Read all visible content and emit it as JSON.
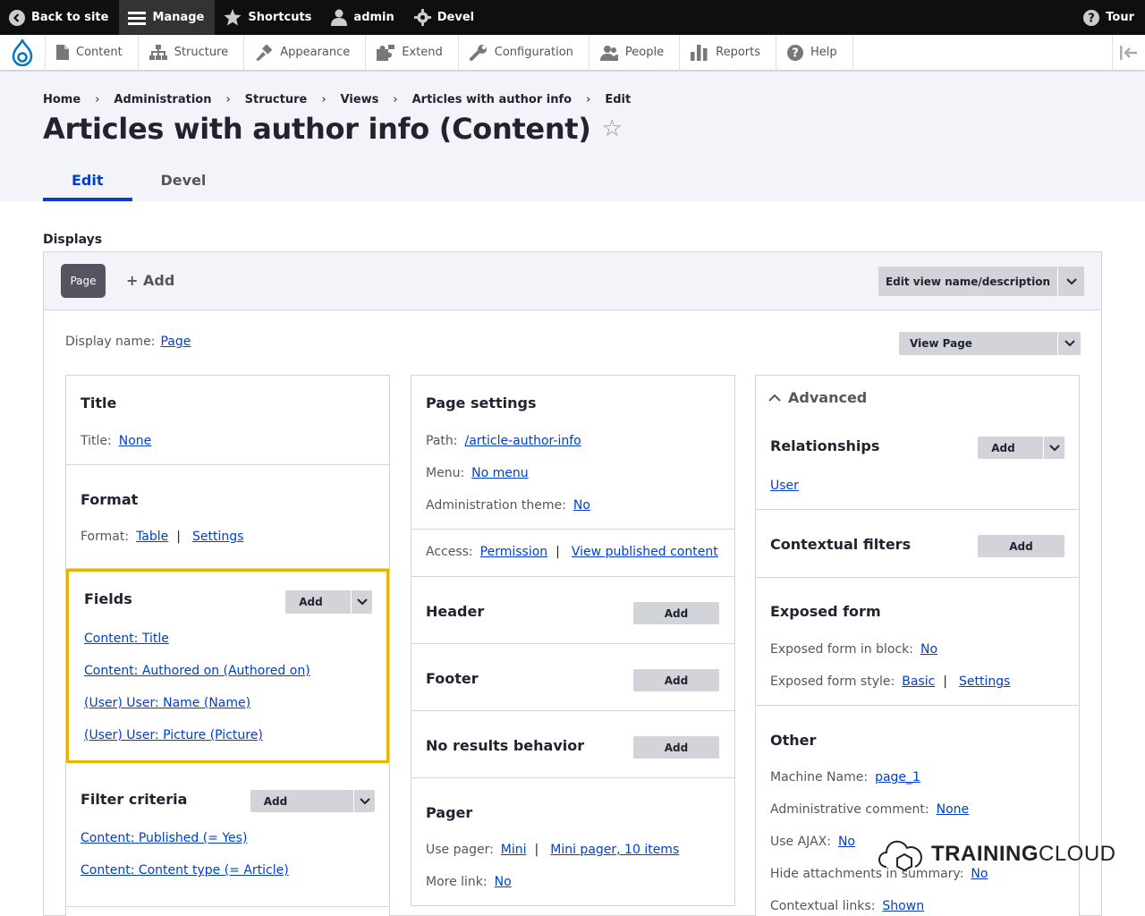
{
  "toolbar": {
    "back_to_site": "Back to site",
    "manage": "Manage",
    "shortcuts": "Shortcuts",
    "user": "admin",
    "devel": "Devel",
    "tour": "Tour"
  },
  "tray": {
    "items": [
      "Content",
      "Structure",
      "Appearance",
      "Extend",
      "Configuration",
      "People",
      "Reports",
      "Help"
    ]
  },
  "breadcrumb": [
    "Home",
    "Administration",
    "Structure",
    "Views",
    "Articles with author info",
    "Edit"
  ],
  "page": {
    "title": "Articles with author info (Content)",
    "star": "☆",
    "tabs": [
      "Edit",
      "Devel"
    ]
  },
  "displays": {
    "label": "Displays",
    "page_pill": "Page",
    "add": "+ Add",
    "edit_view_name": "Edit view name/description",
    "display_name_label": "Display name:",
    "display_name_value": "Page",
    "view_page": "View Page"
  },
  "col1": {
    "title_heading": "Title",
    "title_label": "Title:",
    "title_value": "None",
    "format_heading": "Format",
    "format_label": "Format:",
    "format_value": "Table",
    "format_settings": "Settings",
    "fields_heading": "Fields",
    "fields_add": "Add",
    "fields": [
      "Content: Title",
      "Content: Authored on (Authored on)",
      "(User) User: Name (Name)",
      "(User) User: Picture (Picture)"
    ],
    "filter_heading": "Filter criteria",
    "filter_add": "Add",
    "filters": [
      "Content: Published (= Yes)",
      "Content: Content type (= Article)"
    ]
  },
  "col2": {
    "page_settings_heading": "Page settings",
    "path_label": "Path:",
    "path_value": "/article-author-info",
    "menu_label": "Menu:",
    "menu_value": "No menu",
    "admin_theme_label": "Administration theme:",
    "admin_theme_value": "No",
    "access_label": "Access:",
    "access_value": "Permission",
    "access_value2": "View published content",
    "header_heading": "Header",
    "header_add": "Add",
    "footer_heading": "Footer",
    "footer_add": "Add",
    "noresults_heading": "No results behavior",
    "noresults_add": "Add",
    "pager_heading": "Pager",
    "use_pager_label": "Use pager:",
    "use_pager_value": "Mini",
    "use_pager_value2": "Mini pager, 10 items",
    "more_link_label": "More link:",
    "more_link_value": "No"
  },
  "col3": {
    "advanced_heading": "Advanced",
    "relationships_heading": "Relationships",
    "relationships_add": "Add",
    "relationship_user": "User",
    "contextual_heading": "Contextual filters",
    "contextual_add": "Add",
    "exposed_heading": "Exposed form",
    "exposed_block_label": "Exposed form in block:",
    "exposed_block_value": "No",
    "exposed_style_label": "Exposed form style:",
    "exposed_style_value": "Basic",
    "exposed_style_settings": "Settings",
    "other_heading": "Other",
    "machine_label": "Machine Name:",
    "machine_value": "page_1",
    "admin_comment_label": "Administrative comment:",
    "admin_comment_value": "None",
    "ajax_label": "Use AJAX:",
    "ajax_value": "No",
    "hide_attach_label": "Hide attachments in summary:",
    "hide_attach_value": "No",
    "contextual_links_label": "Contextual links:",
    "contextual_links_value": "Shown"
  },
  "watermark": {
    "bold": "TRAINING",
    "light": "CLOUD"
  }
}
